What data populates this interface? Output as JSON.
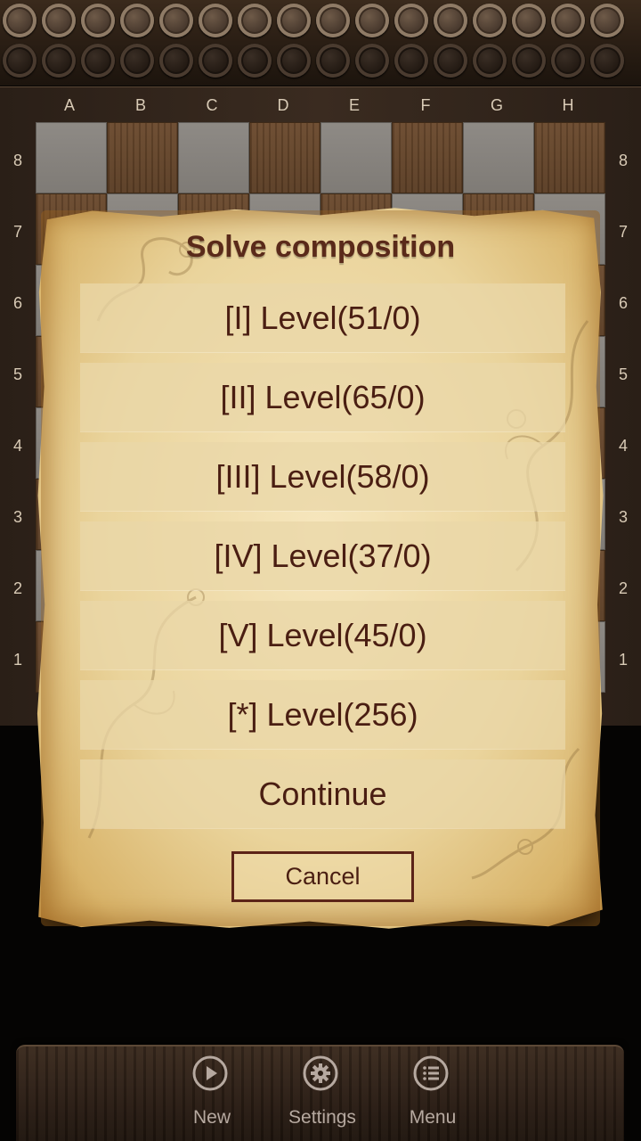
{
  "board": {
    "files": [
      "A",
      "B",
      "C",
      "D",
      "E",
      "F",
      "G",
      "H"
    ],
    "ranks": [
      "8",
      "7",
      "6",
      "5",
      "4",
      "3",
      "2",
      "1"
    ]
  },
  "dialog": {
    "title": "Solve composition",
    "levels": [
      {
        "label": "[I] Level(51/0)"
      },
      {
        "label": "[II] Level(65/0)"
      },
      {
        "label": "[III] Level(58/0)"
      },
      {
        "label": "[IV] Level(37/0)"
      },
      {
        "label": "[V] Level(45/0)"
      },
      {
        "label": "[*] Level(256)"
      },
      {
        "label": "Continue"
      }
    ],
    "cancel_label": "Cancel"
  },
  "bottom_nav": {
    "items": [
      {
        "label": "New",
        "icon": "play-icon"
      },
      {
        "label": "Settings",
        "icon": "gear-icon"
      },
      {
        "label": "Menu",
        "icon": "list-icon"
      }
    ]
  }
}
